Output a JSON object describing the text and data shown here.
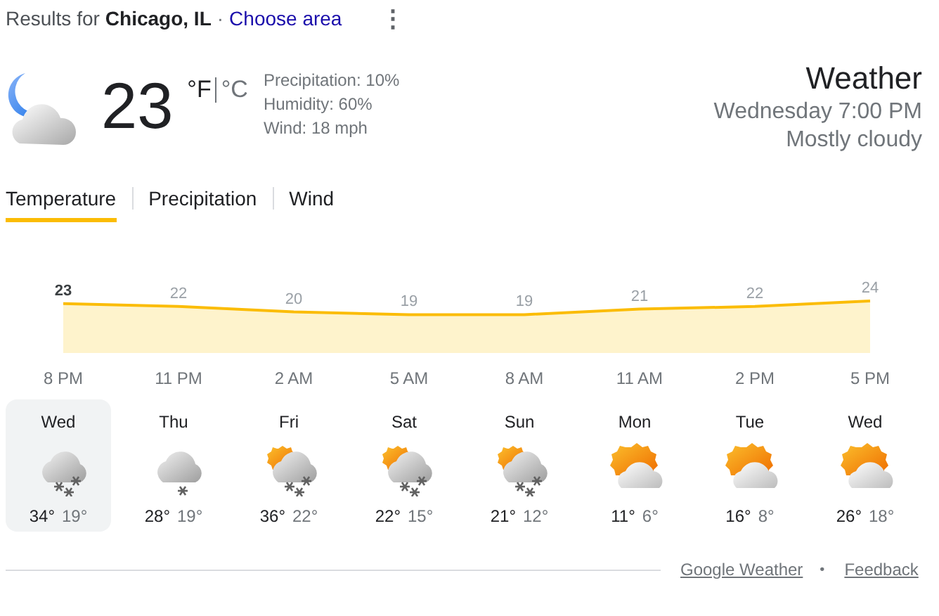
{
  "header": {
    "prefix": "Results for",
    "location": "Chicago, IL",
    "separator": "·",
    "link": "Choose area",
    "menu": "⋮"
  },
  "current": {
    "temperature": "23",
    "units": [
      {
        "label": "°F",
        "selected": true
      },
      {
        "label": "°C",
        "selected": false
      }
    ],
    "details": [
      "Precipitation: 10%",
      "Humidity: 60%",
      "Wind: 18 mph"
    ],
    "title": "Weather",
    "time": "Wednesday 7:00 PM",
    "condition": "Mostly cloudy"
  },
  "tabs": [
    {
      "label": "Temperature",
      "selected": true
    },
    {
      "label": "Precipitation",
      "selected": false
    },
    {
      "label": "Wind",
      "selected": false
    }
  ],
  "chart_data": {
    "type": "area",
    "categories": [
      "8 PM",
      "11 PM",
      "2 AM",
      "5 AM",
      "8 AM",
      "11 AM",
      "2 PM",
      "5 PM"
    ],
    "series": [
      {
        "color": "#fbbc04",
        "values": [
          23,
          22,
          20,
          19,
          19,
          21,
          22,
          24
        ]
      }
    ],
    "data_labels": true
  },
  "days": [
    {
      "day": "Wed",
      "kind": "snow",
      "high": "34°",
      "low": "19°",
      "selected": true
    },
    {
      "day": "Thu",
      "kind": "light-snow",
      "high": "28°",
      "low": "19°",
      "selected": false
    },
    {
      "day": "Fri",
      "kind": "sun-snow",
      "high": "36°",
      "low": "22°",
      "selected": false
    },
    {
      "day": "Sat",
      "kind": "sun-snow",
      "high": "22°",
      "low": "15°",
      "selected": false
    },
    {
      "day": "Sun",
      "kind": "sun-snow",
      "high": "21°",
      "low": "12°",
      "selected": false
    },
    {
      "day": "Mon",
      "kind": "partly-cloudy",
      "high": "11°",
      "low": "6°",
      "selected": false
    },
    {
      "day": "Tue",
      "kind": "partly-cloudy",
      "high": "16°",
      "low": "8°",
      "selected": false
    },
    {
      "day": "Wed",
      "kind": "partly-cloudy",
      "high": "26°",
      "low": "18°",
      "selected": false
    }
  ],
  "footer": {
    "links": [
      "Google Weather",
      "Feedback"
    ],
    "separator": "•"
  }
}
